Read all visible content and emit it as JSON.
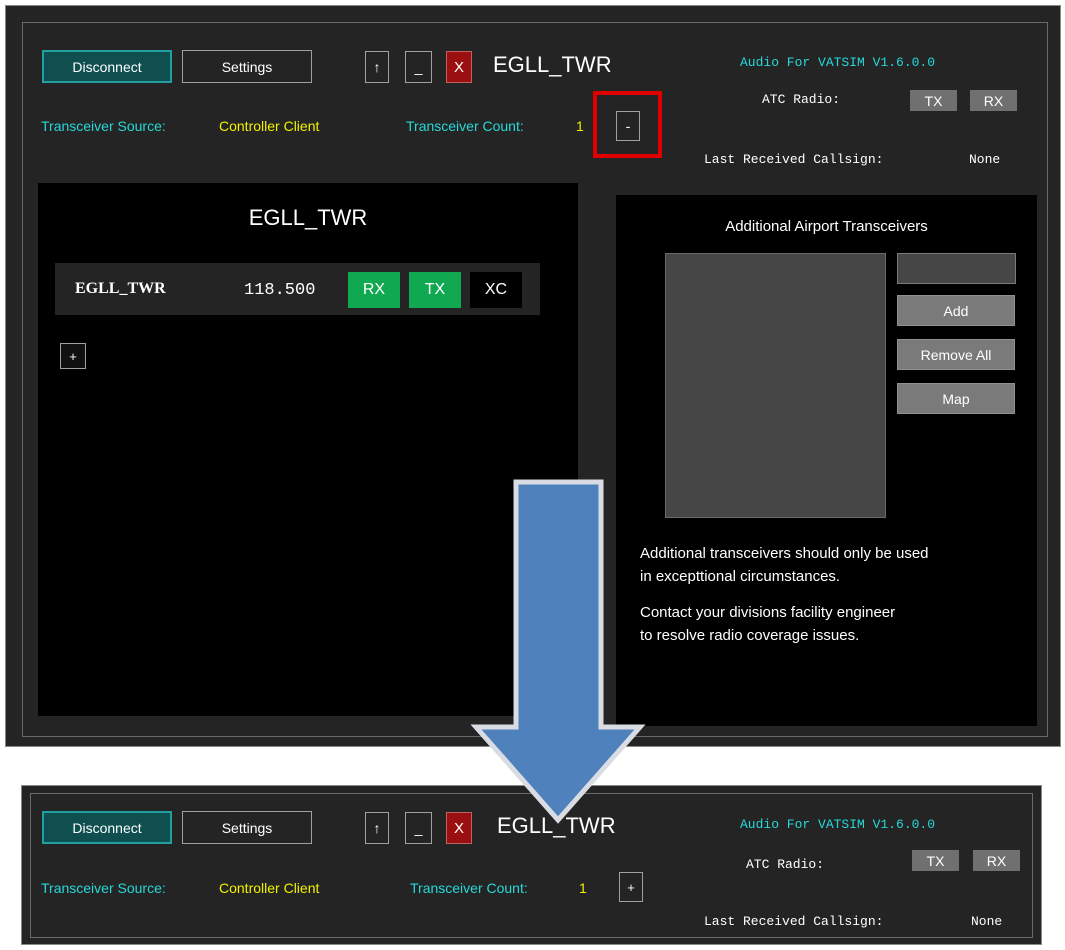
{
  "window": {
    "disconnect_label": "Disconnect",
    "settings_label": "Settings",
    "up_label": "↑",
    "minimize_label": "_",
    "close_label": "X",
    "title": "EGLL_TWR",
    "app_version": "Audio For VATSIM V1.6.0.0",
    "atc_radio_label": "ATC Radio:",
    "tx_label": "TX",
    "rx_label": "RX",
    "transceiver_source_label": "Transceiver Source:",
    "transceiver_source_value": "Controller Client",
    "transceiver_count_label": "Transceiver Count:",
    "transceiver_count_value": "1",
    "last_received_label": "Last Received Callsign:",
    "last_received_value": "None"
  },
  "before": {
    "toggle_label": "-",
    "station_panel": {
      "title": "EGLL_TWR",
      "row": {
        "callsign": "EGLL_TWR",
        "frequency": "118.500",
        "rx": "RX",
        "tx": "TX",
        "xc": "XC"
      },
      "add_label": "+"
    },
    "additional": {
      "title": "Additional Airport Transceivers",
      "add_label": "Add",
      "remove_all_label": "Remove All",
      "map_label": "Map",
      "note1_line1": "Additional transceivers should only be used",
      "note1_line2": "in excepttional circumstances.",
      "note2_line1": "Contact your divisions facility engineer",
      "note2_line2": "to resolve radio coverage issues."
    }
  },
  "after": {
    "toggle_label": "+"
  },
  "colors": {
    "window_bg": "#242424",
    "accent_teal": "#0f4f4f",
    "cyan_text": "#27d8d8",
    "yellow_text": "#f2f200",
    "active_green": "#10a850",
    "highlight_red": "#e00000",
    "arrow_blue": "#4f81bd"
  }
}
